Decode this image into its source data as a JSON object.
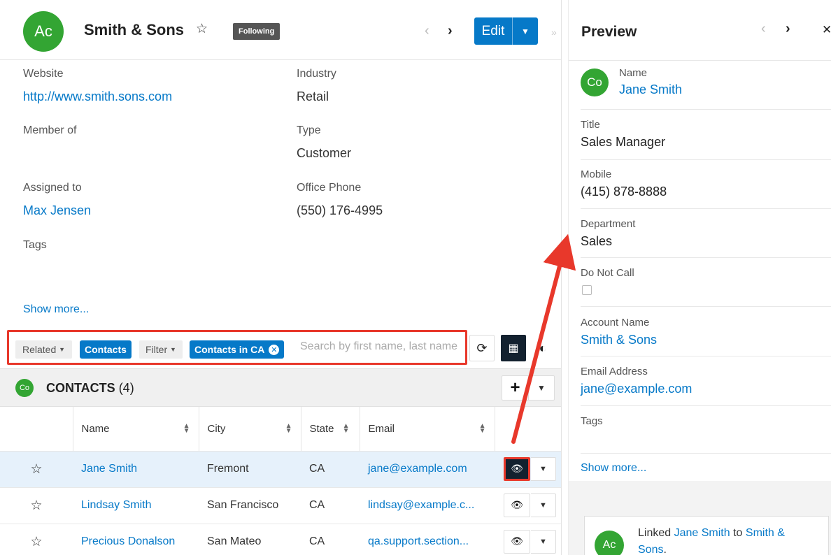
{
  "record": {
    "avatar_text": "Ac",
    "title": "Smith & Sons",
    "following_label": "Following",
    "edit_label": "Edit",
    "fields": {
      "website_label": "Website",
      "website_value": "http://www.smith.sons.com",
      "industry_label": "Industry",
      "industry_value": "Retail",
      "member_of_label": "Member of",
      "type_label": "Type",
      "type_value": "Customer",
      "assigned_to_label": "Assigned to",
      "assigned_to_value": "Max Jensen",
      "office_phone_label": "Office Phone",
      "office_phone_value": "(550) 176-4995",
      "tags_label": "Tags"
    },
    "show_more": "Show more..."
  },
  "filter_bar": {
    "related_label": "Related",
    "related_value": "Contacts",
    "filter_label": "Filter",
    "filter_value": "Contacts in CA",
    "search_placeholder": "Search by first name, last name"
  },
  "subpanel": {
    "avatar_text": "Co",
    "title": "CONTACTS",
    "count": "(4)",
    "columns": [
      "Name",
      "City",
      "State",
      "Email"
    ],
    "rows": [
      {
        "name": "Jane Smith",
        "city": "Fremont",
        "state": "CA",
        "email": "jane@example.com"
      },
      {
        "name": "Lindsay Smith",
        "city": "San Francisco",
        "state": "CA",
        "email": "lindsay@example.c..."
      },
      {
        "name": "Precious Donalson",
        "city": "San Mateo",
        "state": "CA",
        "email": "qa.support.section..."
      }
    ]
  },
  "preview": {
    "title": "Preview",
    "avatar_text": "Co",
    "name_label": "Name",
    "name_value": "Jane Smith",
    "title_label": "Title",
    "title_value": "Sales Manager",
    "mobile_label": "Mobile",
    "mobile_value": "(415) 878-8888",
    "department_label": "Department",
    "department_value": "Sales",
    "do_not_call_label": "Do Not Call",
    "account_name_label": "Account Name",
    "account_name_value": "Smith & Sons",
    "email_label": "Email Address",
    "email_value": "jane@example.com",
    "tags_label": "Tags",
    "show_more": "Show more...",
    "activity": {
      "avatar_text": "Ac",
      "prefix": "Linked",
      "contact": "Jane Smith",
      "middle": "to",
      "account": "Smith &",
      "account2": "Sons",
      "suffix": "."
    }
  },
  "colors": {
    "accent": "#0679c8",
    "avatar_green": "#33a533",
    "highlight_red": "#e8382b"
  },
  "icons": [
    "star-icon",
    "chevron-left-icon",
    "chevron-right-icon",
    "caret-down-icon",
    "refresh-icon",
    "grid-icon",
    "plus-icon",
    "eye-icon",
    "close-icon"
  ]
}
